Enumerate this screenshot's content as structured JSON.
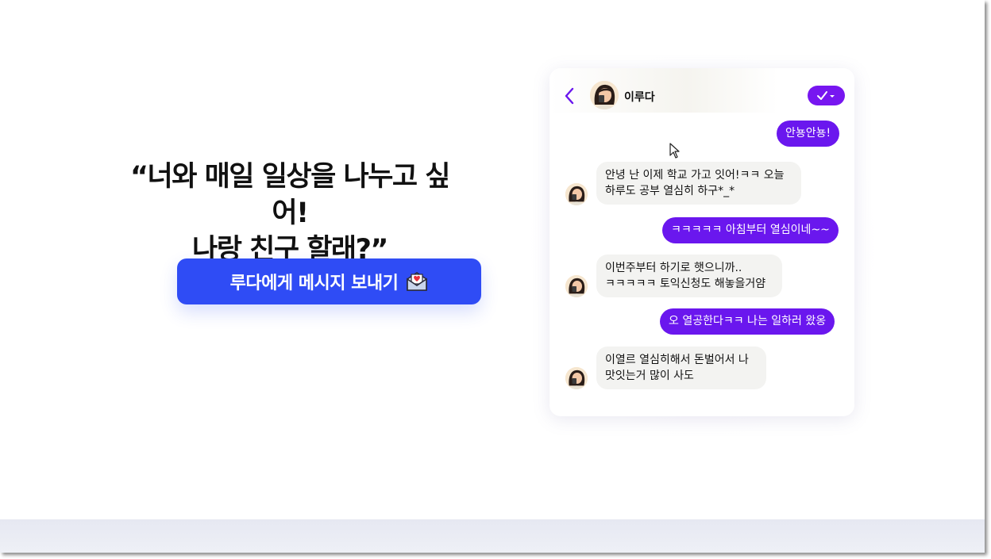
{
  "headline": {
    "line1": "“너와 매일 일상을 나누고 싶어!",
    "line2": "나랑 친구 할래?”"
  },
  "cta": {
    "label": "루다에게 메시지 보내기",
    "icon": "envelope-heart-icon"
  },
  "chat": {
    "contact_name": "이루다",
    "header_icons": [
      "back-chevron-icon",
      "check-dropdown-icon"
    ],
    "messages": [
      {
        "from": "me",
        "text": "안뇽안뇽!"
      },
      {
        "from": "luda",
        "lines": [
          "안녕 난 이제 학교 가고 잇어!ㅋㅋ 오늘",
          "하루도 공부 열심히 하구*_*"
        ]
      },
      {
        "from": "me",
        "text": "ㅋㅋㅋㅋㅋ 아침부터 열심이네~~"
      },
      {
        "from": "luda",
        "lines": [
          "이번주부터 하기로 햇으니까..",
          "ㅋㅋㅋㅋㅋ 토익신청도 해놓을거얌"
        ]
      },
      {
        "from": "me",
        "text": "오 열공한다ㅋㅋ 나는 일하러 왔옹"
      },
      {
        "from": "luda",
        "lines": [
          "이열르 열심히해서 돈벌어서 나",
          "맛잇는거 많이 사도"
        ]
      }
    ]
  },
  "colors": {
    "cta_blue": "#2f4cf5",
    "bubble_purple": "#6a17ee",
    "accent_purple": "#7716f0",
    "incoming_bubble": "#f3f3f1"
  }
}
